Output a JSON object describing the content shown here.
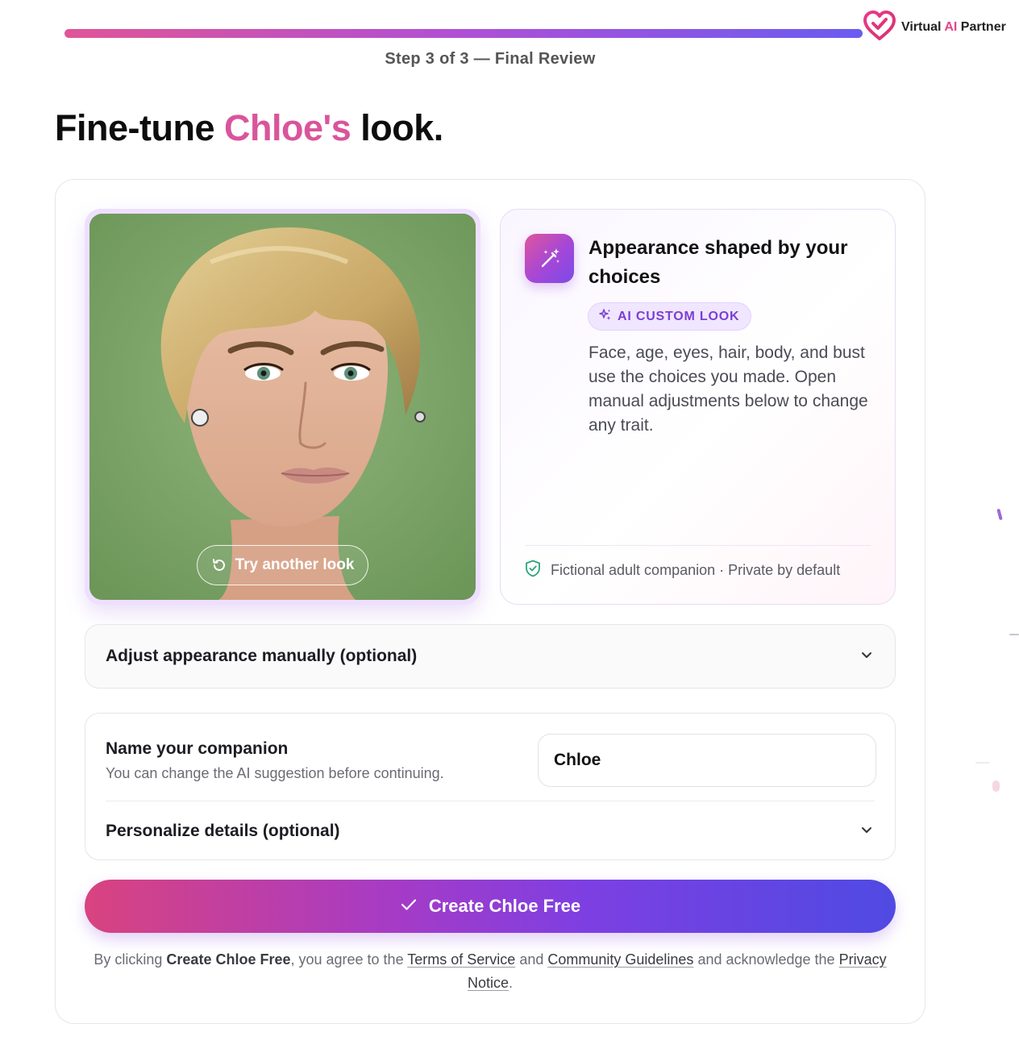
{
  "progress": {
    "step_label": "Step 3 of 3 — Final Review",
    "fraction": 1.0,
    "gradient": [
      "#e05597",
      "#b04fd6",
      "#6a5cf0"
    ]
  },
  "brand": {
    "name_prefix": "Virtual ",
    "name_ai": "AI",
    "name_suffix": " Partner",
    "icon": "heart-logo-icon",
    "color": "#e0468a"
  },
  "header": {
    "title_prefix": "Fine-tune ",
    "title_name": "Chloe's",
    "title_suffix": " look.",
    "accent_color": "#d9559b"
  },
  "preview": {
    "image_icon": "companion-portrait-image",
    "try_button_label": "Try another look",
    "try_button_icon": "refresh-icon"
  },
  "info": {
    "icon": "magic-wand-icon",
    "heading": "Appearance shaped by your choices",
    "badge": "AI CUSTOM LOOK",
    "badge_icon": "sparkles-icon",
    "body": "Face, age, eyes, hair, body, and bust use the choices you made. Open manual adjustments below to change any trait.",
    "footer": "Fictional adult companion · Private by default",
    "footer_icon": "shield-check-icon"
  },
  "manual_adjust": {
    "label": "Adjust appearance manually (optional)",
    "icon": "chevron-down-icon"
  },
  "naming": {
    "title": "Name your companion",
    "subtitle": "You can change the AI suggestion before continuing.",
    "value": "Chloe",
    "personalize_label": "Personalize details (optional)"
  },
  "cta": {
    "label": "Create Chloe Free",
    "icon": "check-icon"
  },
  "legal": {
    "prefix": "By clicking ",
    "cta_name": "Create Chloe Free",
    "middle": ", you agree to the ",
    "terms": "Terms of Service",
    "and": " and ",
    "guidelines": "Community Guidelines",
    "ack": " and acknowledge the ",
    "privacy": "Privacy Notice",
    "end": "."
  }
}
